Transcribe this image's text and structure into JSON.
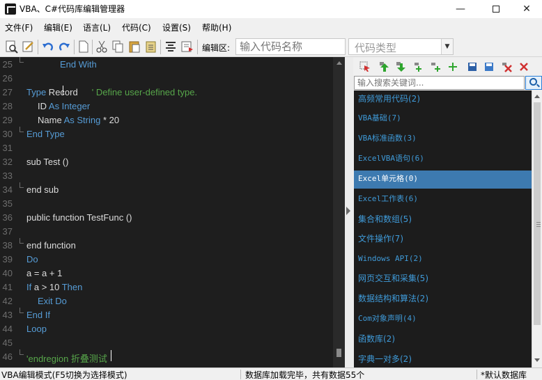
{
  "window": {
    "title": "VBA、C#代码库编辑管理器",
    "minimize": "—",
    "close": "✕"
  },
  "menu": [
    "文件(F)",
    "编辑(E)",
    "语言(L)",
    "代码(C)",
    "设置(S)",
    "帮助(H)"
  ],
  "toolbar": {
    "edit_label": "编辑区:",
    "code_name_placeholder": "输入代码名称",
    "code_type_placeholder": "代码类型"
  },
  "editor": {
    "line_numbers": [
      "25",
      "26",
      "27",
      "28",
      "29",
      "30",
      "31",
      "32",
      "33",
      "34",
      "35",
      "36",
      "37",
      "38",
      "39",
      "40",
      "41",
      "42",
      "43",
      "44",
      "45",
      "46"
    ],
    "lines": {
      "l25": "End With",
      "l27_kw": "Type",
      "l27_name": " Record",
      "l27_cm": "' Define user-defined type.",
      "l28_a": "ID",
      "l28_kw": " As Integer",
      "l29_a": "Name",
      "l29_kw": " As String",
      "l29_b": " * 20",
      "l30": "End Type",
      "l32": "sub Test ()",
      "l34": "end sub",
      "l36": "public function TestFunc ()",
      "l38": "end function",
      "l39": "Do",
      "l40": "a = a + 1",
      "l41_kw": "If",
      "l41_a": " a > 10",
      "l41_kw2": " Then",
      "l42": "Exit Do",
      "l43": "End If",
      "l44": "Loop",
      "l46": "'endregion 折叠测试"
    }
  },
  "sidebar": {
    "search_placeholder": "输入搜索关键词...",
    "categories": [
      "高频常用代码(2)",
      "VBA基础(7)",
      "VBA标准函数(3)",
      "ExcelVBA语句(6)",
      "Excel单元格(0)",
      "Excel工作表(6)",
      "集合和数组(5)",
      "文件操作(7)",
      "Windows API(2)",
      "网页交互和采集(5)",
      "数据结构和算法(2)",
      "Com对象声明(4)",
      "函数库(2)",
      "字典一对多(2)"
    ],
    "selected_category": "Excel单元格(0)"
  },
  "status": {
    "mode": "VBA编辑模式(F5切换为选择模式)",
    "db": "数据库加载完毕，共有数据55个",
    "default_db": "*默认数据库"
  },
  "colors": {
    "editor_bg": "#1e1e1e",
    "keyword": "#569cd6",
    "comment": "#57a64a",
    "list_text": "#3f9ad8",
    "selected": "#3d7ab0"
  }
}
